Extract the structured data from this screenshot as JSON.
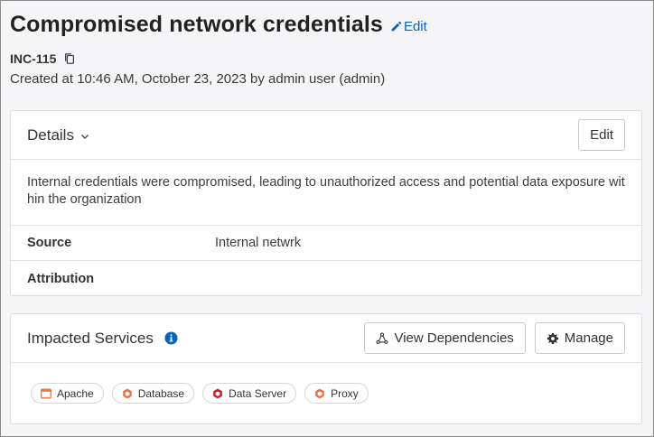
{
  "incident": {
    "title": "Compromised network credentials",
    "edit_label": "Edit",
    "id": "INC-115",
    "created": "Created at 10:46 AM, October 23, 2023 by admin user (admin)"
  },
  "details": {
    "title": "Details",
    "edit_button": "Edit",
    "description": "Internal credentials were compromised, leading to unauthorized access and potential data exposure within the organization",
    "fields": [
      {
        "key": "Source",
        "value": "Internal netwrk"
      },
      {
        "key": "Attribution",
        "value": ""
      }
    ]
  },
  "services": {
    "title": "Impacted Services",
    "view_dependencies": "View Dependencies",
    "manage": "Manage",
    "chips": [
      {
        "label": "Apache",
        "icon": "browser-window-icon",
        "color": "#e4764a"
      },
      {
        "label": "Database",
        "icon": "hexagon-icon",
        "color": "#e4764a"
      },
      {
        "label": "Data Server",
        "icon": "hexagon-icon",
        "color": "#c4222f"
      },
      {
        "label": "Proxy",
        "icon": "hexagon-icon",
        "color": "#e4764a"
      }
    ]
  },
  "colors": {
    "link": "#0a63b5",
    "info": "#0a63b5"
  }
}
